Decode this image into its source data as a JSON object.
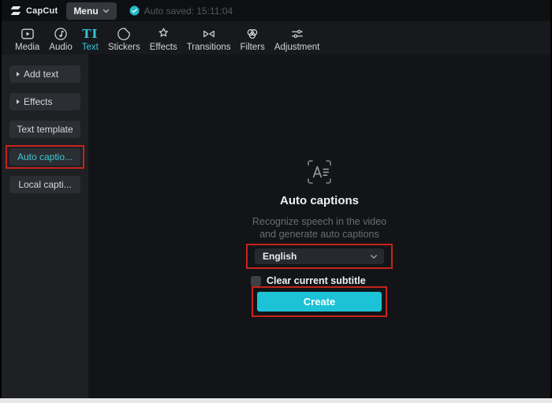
{
  "topbar": {
    "brand": "CapCut",
    "menu_label": "Menu",
    "autosave_text": "Auto saved: 15:11:04"
  },
  "toolbar": {
    "text_icon_glyph": "TI",
    "tabs": [
      {
        "label": "Media",
        "icon": "media-icon",
        "active": false
      },
      {
        "label": "Audio",
        "icon": "audio-icon",
        "active": false
      },
      {
        "label": "Text",
        "icon": "text-icon",
        "active": true
      },
      {
        "label": "Stickers",
        "icon": "stickers-icon",
        "active": false
      },
      {
        "label": "Effects",
        "icon": "effects-icon",
        "active": false
      },
      {
        "label": "Transitions",
        "icon": "transitions-icon",
        "active": false
      },
      {
        "label": "Filters",
        "icon": "filters-icon",
        "active": false
      },
      {
        "label": "Adjustment",
        "icon": "adjustment-icon",
        "active": false
      }
    ]
  },
  "sidebar": {
    "items": [
      {
        "label": "Add text",
        "has_arrow": true,
        "active": false,
        "annotated": false
      },
      {
        "label": "Effects",
        "has_arrow": true,
        "active": false,
        "annotated": false
      },
      {
        "label": "Text template",
        "has_arrow": false,
        "active": false,
        "annotated": false
      },
      {
        "label": "Auto captio...",
        "has_arrow": false,
        "active": true,
        "annotated": true
      },
      {
        "label": "Local capti...",
        "has_arrow": false,
        "active": false,
        "annotated": false
      }
    ]
  },
  "panel": {
    "icon": "auto-captions-icon",
    "title": "Auto captions",
    "description_line1": "Recognize speech in the video",
    "description_line2": "and generate auto captions",
    "language_select": {
      "value": "English"
    },
    "checkbox": {
      "label": "Clear current subtitle",
      "checked": false
    },
    "create_button_label": "Create"
  },
  "colors": {
    "accent_cyan": "#35c6d8",
    "create_button_bg": "#1cc2d6",
    "annotation_red": "#c3241c",
    "autosave_check_teal": "#25b8c6"
  }
}
